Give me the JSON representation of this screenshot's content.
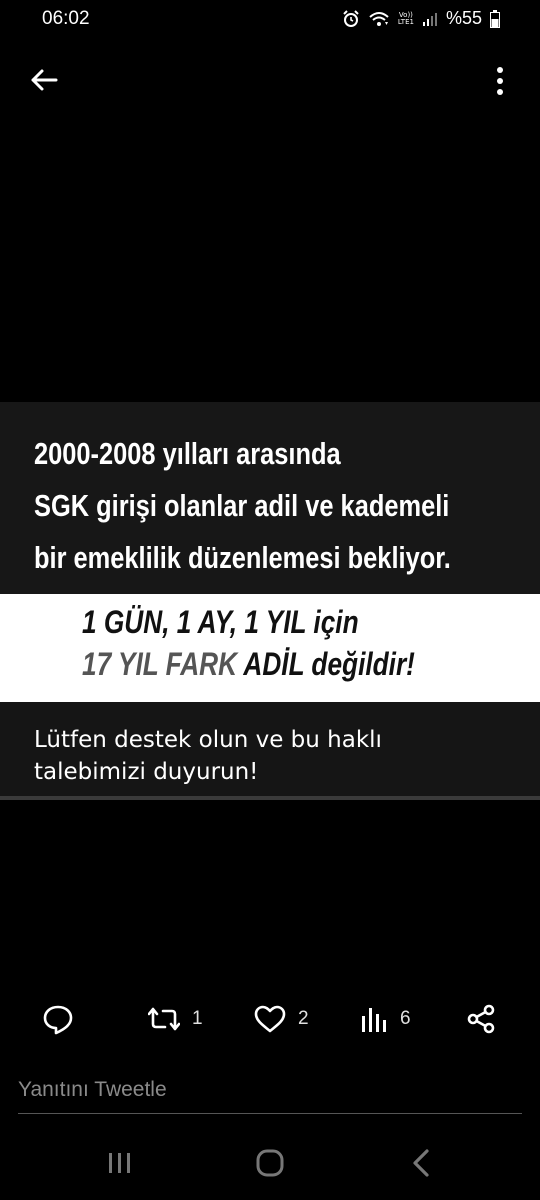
{
  "status_bar": {
    "time": "06:02",
    "volte_line1": "Vo))",
    "volte_line2": "LTE1",
    "battery": "%55",
    "icons": [
      "alarm-icon",
      "wifi-icon",
      "volte-icon",
      "signal-icon",
      "battery-icon"
    ]
  },
  "top_bar": {
    "back_icon": "arrow-left-icon",
    "more_icon": "more-vertical-icon"
  },
  "image": {
    "line1": "2000-2008 yılları arasında",
    "line2": "SGK girişi olanlar adil ve kademeli",
    "line3": "bir emeklilik düzenlemesi bekliyor.",
    "highlight_line1": "1 GÜN, 1 AY, 1 YIL için",
    "highlight_line2_a": "17 YIL FARK",
    "highlight_line2_b": " ADİL değildir!",
    "footer_line1": "Lütfen destek olun ve bu haklı",
    "footer_line2": "talebimizi duyurun!",
    "colors": {
      "dark_panel": "#171717",
      "white_panel": "#ffffff",
      "gray_text": "#555555"
    }
  },
  "actions": {
    "reply_icon": "comment-icon",
    "retweet_icon": "retweet-icon",
    "retweet_count": "1",
    "like_icon": "heart-icon",
    "like_count": "2",
    "views_icon": "bar-chart-icon",
    "views_count": "6",
    "share_icon": "share-icon"
  },
  "reply": {
    "placeholder": "Yanıtını Tweetle"
  },
  "nav_bar": {
    "icons": [
      "recents-icon",
      "home-icon",
      "back-icon"
    ]
  }
}
